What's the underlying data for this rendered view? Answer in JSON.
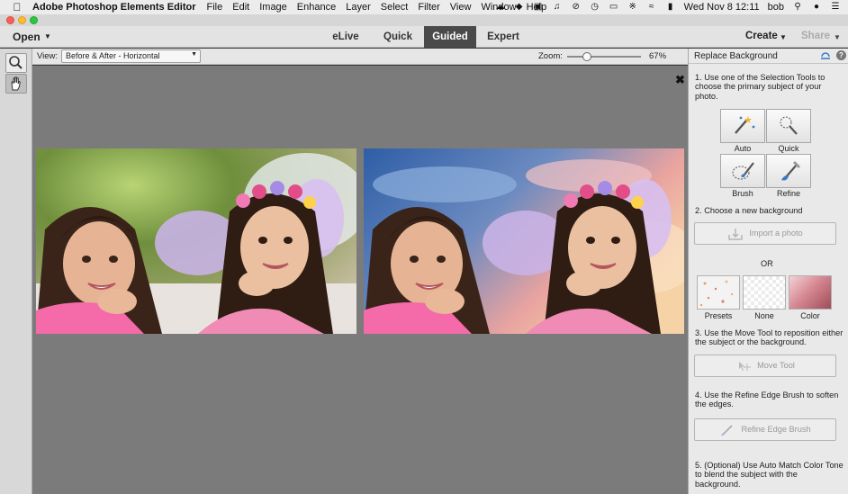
{
  "menubar": {
    "app_name": "Adobe Photoshop Elements Editor",
    "items": [
      "File",
      "Edit",
      "Image",
      "Enhance",
      "Layer",
      "Select",
      "Filter",
      "View",
      "Window",
      "Help"
    ],
    "clock": "Wed Nov 8  12:11",
    "user": "bob"
  },
  "appbar": {
    "open_label": "Open",
    "tabs": [
      "eLive",
      "Quick",
      "Guided",
      "Expert"
    ],
    "active_tab": "Guided",
    "create_label": "Create",
    "share_label": "Share"
  },
  "options": {
    "view_label": "View:",
    "view_value": "Before & After - Horizontal",
    "zoom_label": "Zoom:",
    "zoom_value": "67%"
  },
  "panel": {
    "title": "Replace Background",
    "step1": "1. Use one of the Selection Tools to choose the primary subject of your photo.",
    "tools": {
      "auto": "Auto",
      "quick": "Quick",
      "brush": "Brush",
      "refine": "Refine"
    },
    "step2": "2. Choose a new background",
    "import_photo": "Import a photo",
    "or": "OR",
    "backgrounds": {
      "presets": "Presets",
      "none": "None",
      "color": "Color"
    },
    "step3": "3. Use the Move Tool to reposition either the subject or the background.",
    "move_tool": "Move Tool",
    "step4": "4. Use the Refine Edge Brush to soften the edges.",
    "refine_edge": "Refine Edge Brush",
    "step5": "5. (Optional) Use Auto Match Color Tone to blend the subject with the background."
  },
  "icons": {
    "apple": "apple-logo-icon",
    "zoom_tool": "magnifier-icon",
    "hand_tool": "hand-icon",
    "close_compare": "close-icon",
    "reset": "reset-icon",
    "help": "help-icon"
  }
}
